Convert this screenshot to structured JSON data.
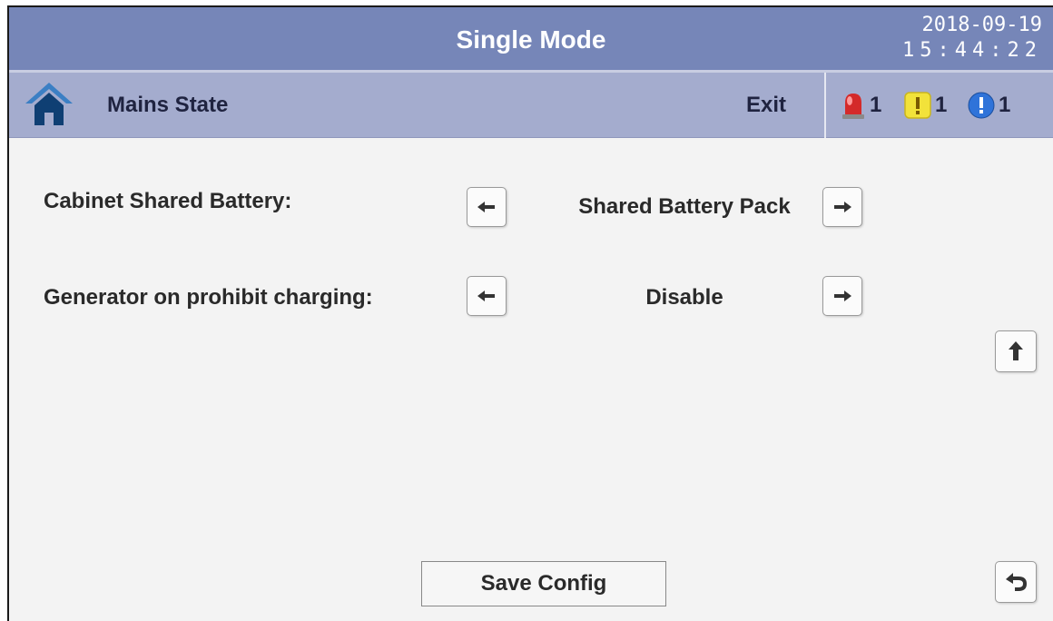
{
  "header": {
    "title": "Single Mode",
    "date": "2018-09-19",
    "time": "15:44:22"
  },
  "subheader": {
    "home_icon": "home-icon",
    "title": "Mains State",
    "exit_label": "Exit",
    "alarms": [
      {
        "icon": "siren-icon",
        "count": "1",
        "color": "#d42a2a"
      },
      {
        "icon": "warning-icon",
        "count": "1",
        "color": "#f2e23a"
      },
      {
        "icon": "info-icon",
        "count": "1",
        "color": "#2f73d9"
      }
    ]
  },
  "settings": [
    {
      "label": "Cabinet Shared Battery:",
      "value": "Shared Battery Pack"
    },
    {
      "label": "Generator on prohibit charging:",
      "value": "Disable"
    }
  ],
  "buttons": {
    "save_label": "Save Config"
  }
}
